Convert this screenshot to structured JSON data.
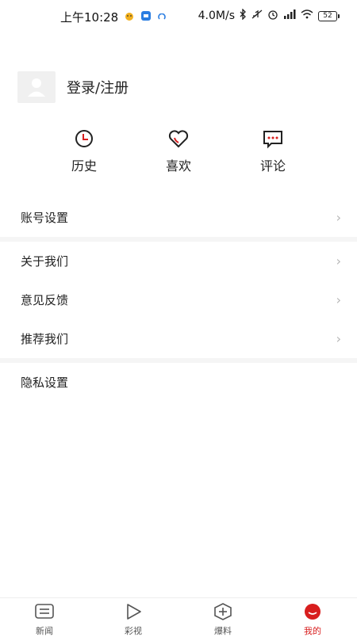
{
  "status_bar": {
    "time": "上午10:28",
    "network_speed": "4.0M/s",
    "battery": "52"
  },
  "profile": {
    "login_label": "登录/注册"
  },
  "quick_actions": [
    {
      "label": "历史",
      "icon": "clock-icon"
    },
    {
      "label": "喜欢",
      "icon": "heart-icon"
    },
    {
      "label": "评论",
      "icon": "comment-icon"
    }
  ],
  "menu": {
    "account_settings": "账号设置",
    "about_us": "关于我们",
    "feedback": "意见反馈",
    "recommend": "推荐我们",
    "privacy": "隐私设置"
  },
  "tabbar": {
    "items": [
      {
        "label": "新闻",
        "icon": "news-icon"
      },
      {
        "label": "彩视",
        "icon": "play-icon"
      },
      {
        "label": "爆料",
        "icon": "plus-icon"
      },
      {
        "label": "我的",
        "icon": "profile-icon"
      }
    ],
    "active_index": 3,
    "accent_color": "#d81e1e"
  }
}
